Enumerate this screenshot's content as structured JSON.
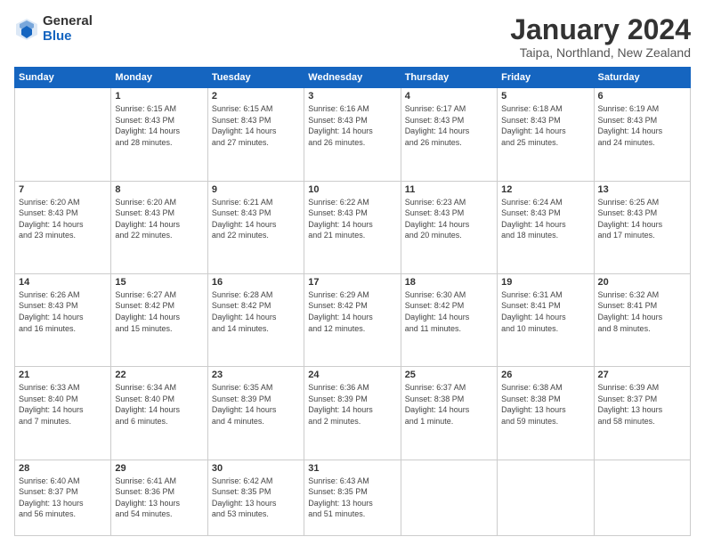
{
  "header": {
    "logo": {
      "general": "General",
      "blue": "Blue"
    },
    "title": "January 2024",
    "location": "Taipa, Northland, New Zealand"
  },
  "weekdays": [
    "Sunday",
    "Monday",
    "Tuesday",
    "Wednesday",
    "Thursday",
    "Friday",
    "Saturday"
  ],
  "weeks": [
    [
      {
        "num": "",
        "detail": ""
      },
      {
        "num": "1",
        "detail": "Sunrise: 6:15 AM\nSunset: 8:43 PM\nDaylight: 14 hours\nand 28 minutes."
      },
      {
        "num": "2",
        "detail": "Sunrise: 6:15 AM\nSunset: 8:43 PM\nDaylight: 14 hours\nand 27 minutes."
      },
      {
        "num": "3",
        "detail": "Sunrise: 6:16 AM\nSunset: 8:43 PM\nDaylight: 14 hours\nand 26 minutes."
      },
      {
        "num": "4",
        "detail": "Sunrise: 6:17 AM\nSunset: 8:43 PM\nDaylight: 14 hours\nand 26 minutes."
      },
      {
        "num": "5",
        "detail": "Sunrise: 6:18 AM\nSunset: 8:43 PM\nDaylight: 14 hours\nand 25 minutes."
      },
      {
        "num": "6",
        "detail": "Sunrise: 6:19 AM\nSunset: 8:43 PM\nDaylight: 14 hours\nand 24 minutes."
      }
    ],
    [
      {
        "num": "7",
        "detail": "Sunrise: 6:20 AM\nSunset: 8:43 PM\nDaylight: 14 hours\nand 23 minutes."
      },
      {
        "num": "8",
        "detail": "Sunrise: 6:20 AM\nSunset: 8:43 PM\nDaylight: 14 hours\nand 22 minutes."
      },
      {
        "num": "9",
        "detail": "Sunrise: 6:21 AM\nSunset: 8:43 PM\nDaylight: 14 hours\nand 22 minutes."
      },
      {
        "num": "10",
        "detail": "Sunrise: 6:22 AM\nSunset: 8:43 PM\nDaylight: 14 hours\nand 21 minutes."
      },
      {
        "num": "11",
        "detail": "Sunrise: 6:23 AM\nSunset: 8:43 PM\nDaylight: 14 hours\nand 20 minutes."
      },
      {
        "num": "12",
        "detail": "Sunrise: 6:24 AM\nSunset: 8:43 PM\nDaylight: 14 hours\nand 18 minutes."
      },
      {
        "num": "13",
        "detail": "Sunrise: 6:25 AM\nSunset: 8:43 PM\nDaylight: 14 hours\nand 17 minutes."
      }
    ],
    [
      {
        "num": "14",
        "detail": "Sunrise: 6:26 AM\nSunset: 8:43 PM\nDaylight: 14 hours\nand 16 minutes."
      },
      {
        "num": "15",
        "detail": "Sunrise: 6:27 AM\nSunset: 8:42 PM\nDaylight: 14 hours\nand 15 minutes."
      },
      {
        "num": "16",
        "detail": "Sunrise: 6:28 AM\nSunset: 8:42 PM\nDaylight: 14 hours\nand 14 minutes."
      },
      {
        "num": "17",
        "detail": "Sunrise: 6:29 AM\nSunset: 8:42 PM\nDaylight: 14 hours\nand 12 minutes."
      },
      {
        "num": "18",
        "detail": "Sunrise: 6:30 AM\nSunset: 8:42 PM\nDaylight: 14 hours\nand 11 minutes."
      },
      {
        "num": "19",
        "detail": "Sunrise: 6:31 AM\nSunset: 8:41 PM\nDaylight: 14 hours\nand 10 minutes."
      },
      {
        "num": "20",
        "detail": "Sunrise: 6:32 AM\nSunset: 8:41 PM\nDaylight: 14 hours\nand 8 minutes."
      }
    ],
    [
      {
        "num": "21",
        "detail": "Sunrise: 6:33 AM\nSunset: 8:40 PM\nDaylight: 14 hours\nand 7 minutes."
      },
      {
        "num": "22",
        "detail": "Sunrise: 6:34 AM\nSunset: 8:40 PM\nDaylight: 14 hours\nand 6 minutes."
      },
      {
        "num": "23",
        "detail": "Sunrise: 6:35 AM\nSunset: 8:39 PM\nDaylight: 14 hours\nand 4 minutes."
      },
      {
        "num": "24",
        "detail": "Sunrise: 6:36 AM\nSunset: 8:39 PM\nDaylight: 14 hours\nand 2 minutes."
      },
      {
        "num": "25",
        "detail": "Sunrise: 6:37 AM\nSunset: 8:38 PM\nDaylight: 14 hours\nand 1 minute."
      },
      {
        "num": "26",
        "detail": "Sunrise: 6:38 AM\nSunset: 8:38 PM\nDaylight: 13 hours\nand 59 minutes."
      },
      {
        "num": "27",
        "detail": "Sunrise: 6:39 AM\nSunset: 8:37 PM\nDaylight: 13 hours\nand 58 minutes."
      }
    ],
    [
      {
        "num": "28",
        "detail": "Sunrise: 6:40 AM\nSunset: 8:37 PM\nDaylight: 13 hours\nand 56 minutes."
      },
      {
        "num": "29",
        "detail": "Sunrise: 6:41 AM\nSunset: 8:36 PM\nDaylight: 13 hours\nand 54 minutes."
      },
      {
        "num": "30",
        "detail": "Sunrise: 6:42 AM\nSunset: 8:35 PM\nDaylight: 13 hours\nand 53 minutes."
      },
      {
        "num": "31",
        "detail": "Sunrise: 6:43 AM\nSunset: 8:35 PM\nDaylight: 13 hours\nand 51 minutes."
      },
      {
        "num": "",
        "detail": ""
      },
      {
        "num": "",
        "detail": ""
      },
      {
        "num": "",
        "detail": ""
      }
    ]
  ]
}
